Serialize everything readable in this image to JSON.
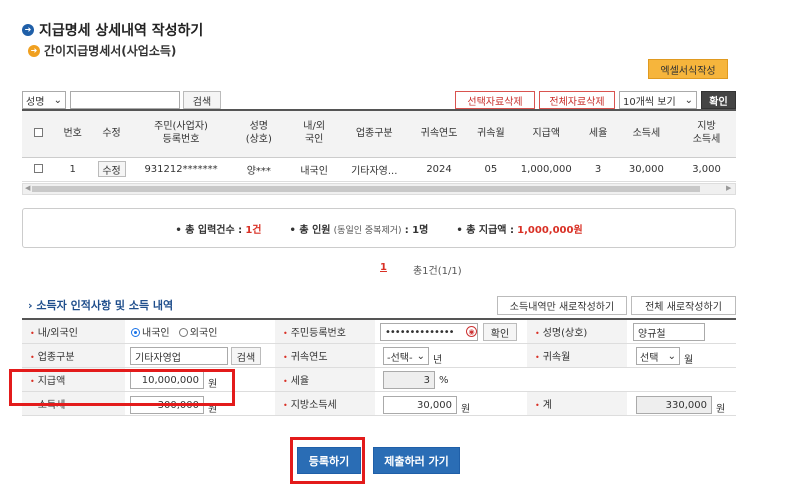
{
  "page": {
    "title": "지급명세 상세내역 작성하기",
    "subtitle": "간이지급명세서(사업소득)",
    "excel_button": "엑셀서식작성"
  },
  "toolbar": {
    "search_field_select": "성명",
    "search_input_value": "",
    "search_button": "검색",
    "delete_selected": "선택자료삭제",
    "delete_all": "전체자료삭제",
    "page_size_select": "10개씩 보기",
    "confirm_button": "확인"
  },
  "grid": {
    "columns": [
      "번호",
      "수정",
      "주민(사업자)\n등록번호",
      "성명\n(상호)",
      "내/외\n국인",
      "업종구분",
      "귀속연도",
      "귀속월",
      "지급액",
      "세율",
      "소득세",
      "지방\n소득세"
    ],
    "rows": [
      {
        "no": "1",
        "edit": "수정",
        "reg_no": "931212*******",
        "name": "양***",
        "nationality": "내국인",
        "business_type": "기타자영...",
        "year": "2024",
        "month": "05",
        "payment": "1,000,000",
        "tax_rate": "3",
        "income_tax": "30,000",
        "local_tax": "3,000"
      }
    ]
  },
  "summary": {
    "total_count_label": "총 입력건수 :",
    "total_count_value": "1건",
    "total_people_label": "총 인원",
    "total_people_note": "(동일인 중복제거)",
    "total_people_value": ": 1명",
    "total_payment_label": "총 지급액 :",
    "total_payment_value": "1,000,000원"
  },
  "pagination": {
    "current": "1",
    "total_text": "총1건(1/1)"
  },
  "form": {
    "section_title": "소득자 인적사항 및 소득 내역",
    "new_income_only": "소득내역만 새로작성하기",
    "new_all": "전체 새로작성하기",
    "nationality_label": "내/외국인",
    "nationality_domestic": "내국인",
    "nationality_foreign": "외국인",
    "reg_no_label": "주민등록번호",
    "reg_no_value": "••••••••••••••",
    "reg_no_confirm": "확인",
    "name_label": "성명(상호)",
    "name_value": "양규철",
    "business_label": "업종구분",
    "business_value": "기타자영업",
    "business_search": "검색",
    "year_label": "귀속연도",
    "year_select": "-선택-",
    "year_unit": "년",
    "month_label": "귀속월",
    "month_select": "선택",
    "month_unit": "월",
    "payment_label": "지급액",
    "payment_value": "10,000,000",
    "payment_unit": "원",
    "rate_label": "세율",
    "rate_value": "3",
    "rate_unit": "%",
    "income_tax_label": "소득세",
    "income_tax_value": "300,000",
    "income_tax_unit": "원",
    "local_tax_label": "지방소득세",
    "local_tax_value": "30,000",
    "local_tax_unit": "원",
    "total_label": "계",
    "total_value": "330,000",
    "total_unit": "원"
  },
  "actions": {
    "register": "등록하기",
    "submit": "제출하러 가기"
  },
  "colors": {
    "accent_blue": "#2a6db5",
    "highlight_red": "#e31b1b",
    "excel_orange": "#f6b53c"
  }
}
